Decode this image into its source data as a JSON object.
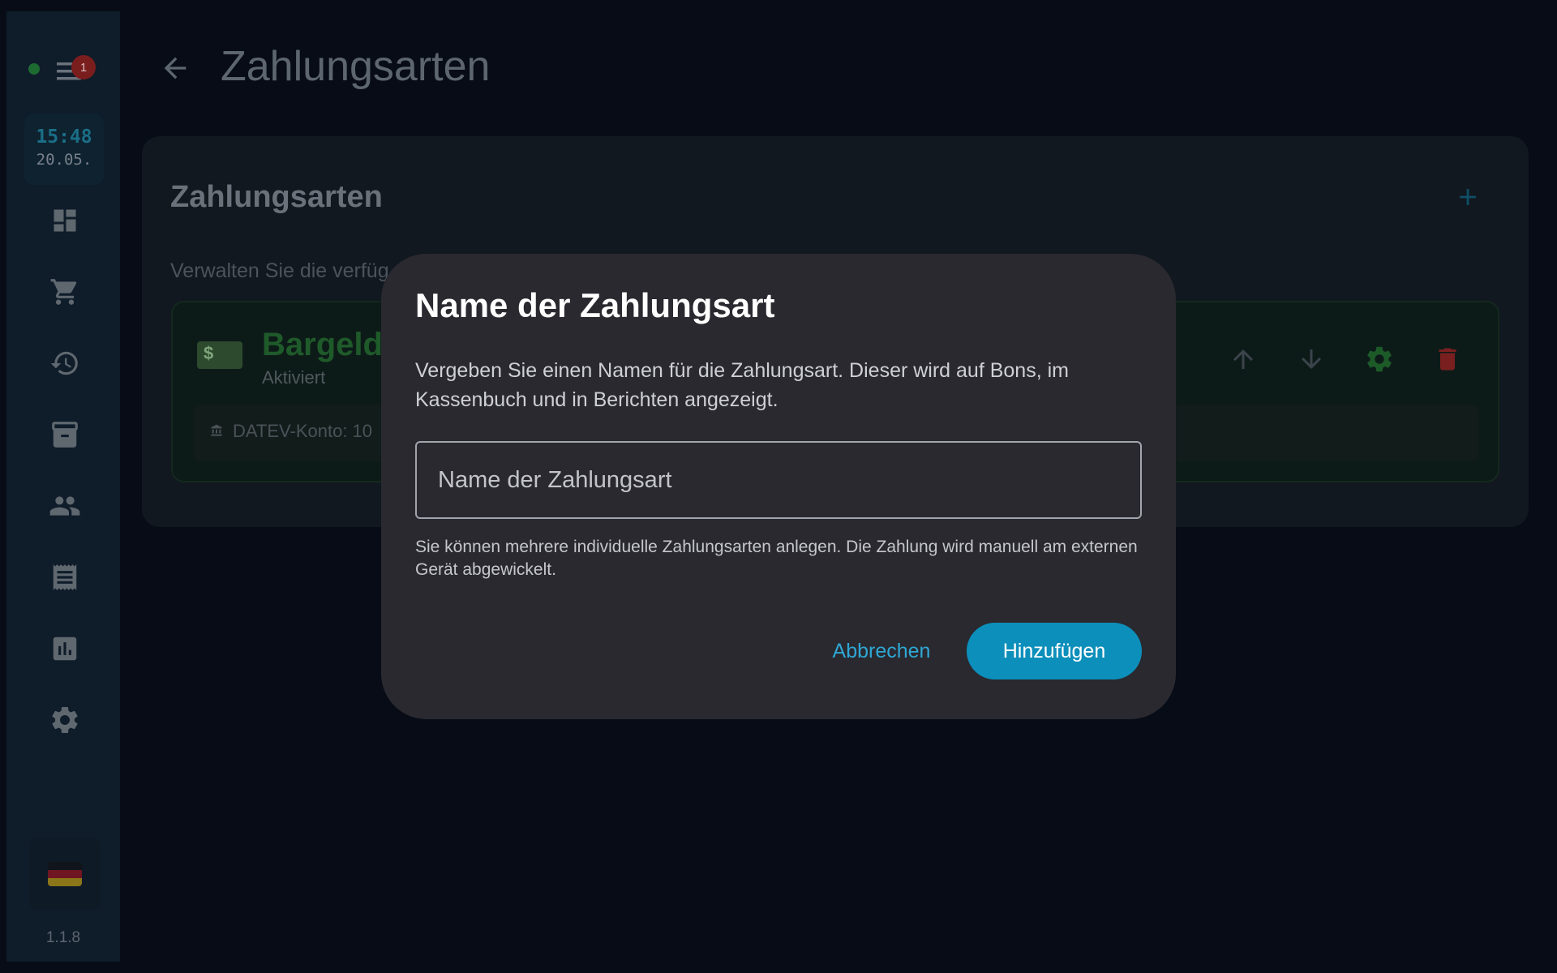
{
  "sidebar": {
    "notification_count": "1",
    "clock": {
      "time": "15:48",
      "date": "20.05."
    },
    "nav_items": [
      {
        "name": "dashboard-icon"
      },
      {
        "name": "cart-icon"
      },
      {
        "name": "history-icon"
      },
      {
        "name": "archive-icon"
      },
      {
        "name": "people-icon"
      },
      {
        "name": "receipt-icon"
      },
      {
        "name": "chart-icon"
      },
      {
        "name": "settings-icon"
      }
    ],
    "language": "de",
    "version": "1.1.8"
  },
  "header": {
    "title": "Zahlungsarten"
  },
  "card": {
    "title": "Zahlungsarten",
    "description": "Verwalten Sie die verfüg",
    "payment_methods": [
      {
        "name": "Bargeld",
        "status": "Aktiviert",
        "datev": "DATEV-Konto: 10"
      }
    ]
  },
  "dialog": {
    "title": "Name der Zahlungsart",
    "description": "Vergeben Sie einen Namen für die Zahlungsart. Dieser wird auf Bons, im Kassenbuch und in Berichten angezeigt.",
    "input_placeholder": "Name der Zahlungsart",
    "input_value": "",
    "help_text": "Sie können mehrere individuelle Zahlungsarten anlegen. Die Zahlung wird manuell am externen Gerät abgewickelt.",
    "cancel_label": "Abbrechen",
    "add_label": "Hinzufügen"
  },
  "colors": {
    "accent": "#0d8fbb",
    "link": "#2fa7d4",
    "active_green": "#1f5a2a",
    "delete_red": "#8a1f1f"
  }
}
